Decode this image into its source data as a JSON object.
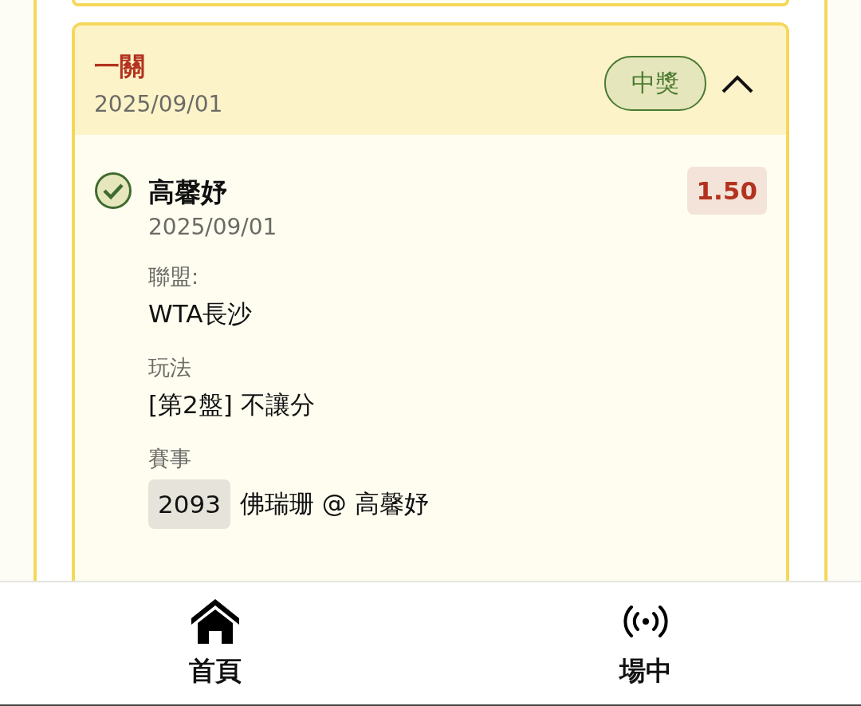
{
  "bet": {
    "type": "一關",
    "date": "2025/09/01",
    "status": "中獎",
    "expanded": true,
    "selections": [
      {
        "won": true,
        "name": "高馨妤",
        "date": "2025/09/01",
        "odds": "1.50",
        "fields": [
          {
            "label": "聯盟:",
            "value": "WTA長沙"
          },
          {
            "label": "玩法",
            "value": "[第2盤] 不讓分"
          },
          {
            "label": "賽事",
            "code": "2093",
            "value": "佛瑞珊 @ 高馨妤"
          }
        ]
      }
    ]
  },
  "nav": [
    {
      "kind": "home",
      "label": "首頁"
    },
    {
      "kind": "live",
      "label": "場中"
    }
  ]
}
